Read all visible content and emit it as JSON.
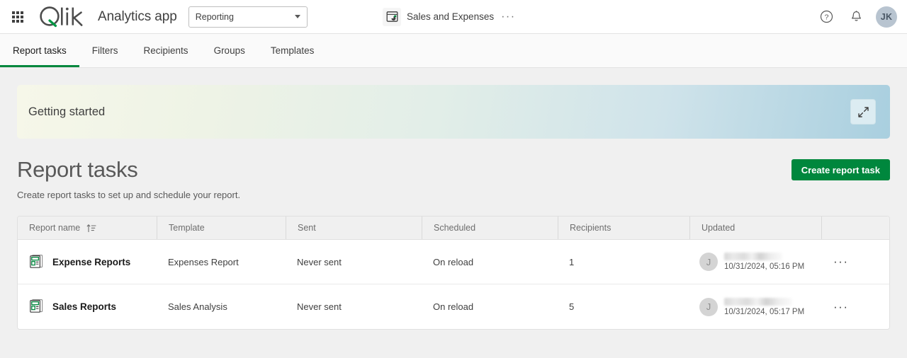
{
  "header": {
    "app_launcher_label": "app-launcher",
    "logo_text": "Qlik",
    "app_title": "Analytics app",
    "space_selector": {
      "value": "Reporting",
      "options": [
        "Reporting"
      ]
    },
    "document_name": "Sales and Expenses",
    "document_more_label": "···",
    "help_label": "?",
    "notifications_label": "notifications",
    "user_initials": "JK"
  },
  "tabs": [
    {
      "label": "Report tasks",
      "active": true
    },
    {
      "label": "Filters",
      "active": false
    },
    {
      "label": "Recipients",
      "active": false
    },
    {
      "label": "Groups",
      "active": false
    },
    {
      "label": "Templates",
      "active": false
    }
  ],
  "banner": {
    "title": "Getting started",
    "expand_label": "expand"
  },
  "page": {
    "title": "Report tasks",
    "subtitle": "Create report tasks to set up and schedule your report.",
    "create_button": "Create report task"
  },
  "table": {
    "columns": [
      {
        "key": "name",
        "label": "Report name",
        "sorted": true
      },
      {
        "key": "template",
        "label": "Template",
        "sorted": false
      },
      {
        "key": "sent",
        "label": "Sent",
        "sorted": false
      },
      {
        "key": "scheduled",
        "label": "Scheduled",
        "sorted": false
      },
      {
        "key": "recipients",
        "label": "Recipients",
        "sorted": false
      },
      {
        "key": "updated",
        "label": "Updated",
        "sorted": false
      },
      {
        "key": "actions",
        "label": "",
        "sorted": false
      }
    ],
    "rows": [
      {
        "name": "Expense Reports",
        "template": "Expenses Report",
        "sent": "Never sent",
        "scheduled": "On reload",
        "recipients": "1",
        "updated_by_initial": "J",
        "updated_by_name": "",
        "updated_date": "10/31/2024, 05:16 PM",
        "actions_label": "···"
      },
      {
        "name": "Sales Reports",
        "template": "Sales Analysis",
        "sent": "Never sent",
        "scheduled": "On reload",
        "recipients": "5",
        "updated_by_initial": "J",
        "updated_by_name": "",
        "updated_date": "10/31/2024, 05:17 PM",
        "actions_label": "···"
      }
    ]
  },
  "colors": {
    "brand_green": "#00873d",
    "page_bg": "#f0f0f0",
    "text": "#404040",
    "avatar_top_bg": "#b8c4d0"
  }
}
